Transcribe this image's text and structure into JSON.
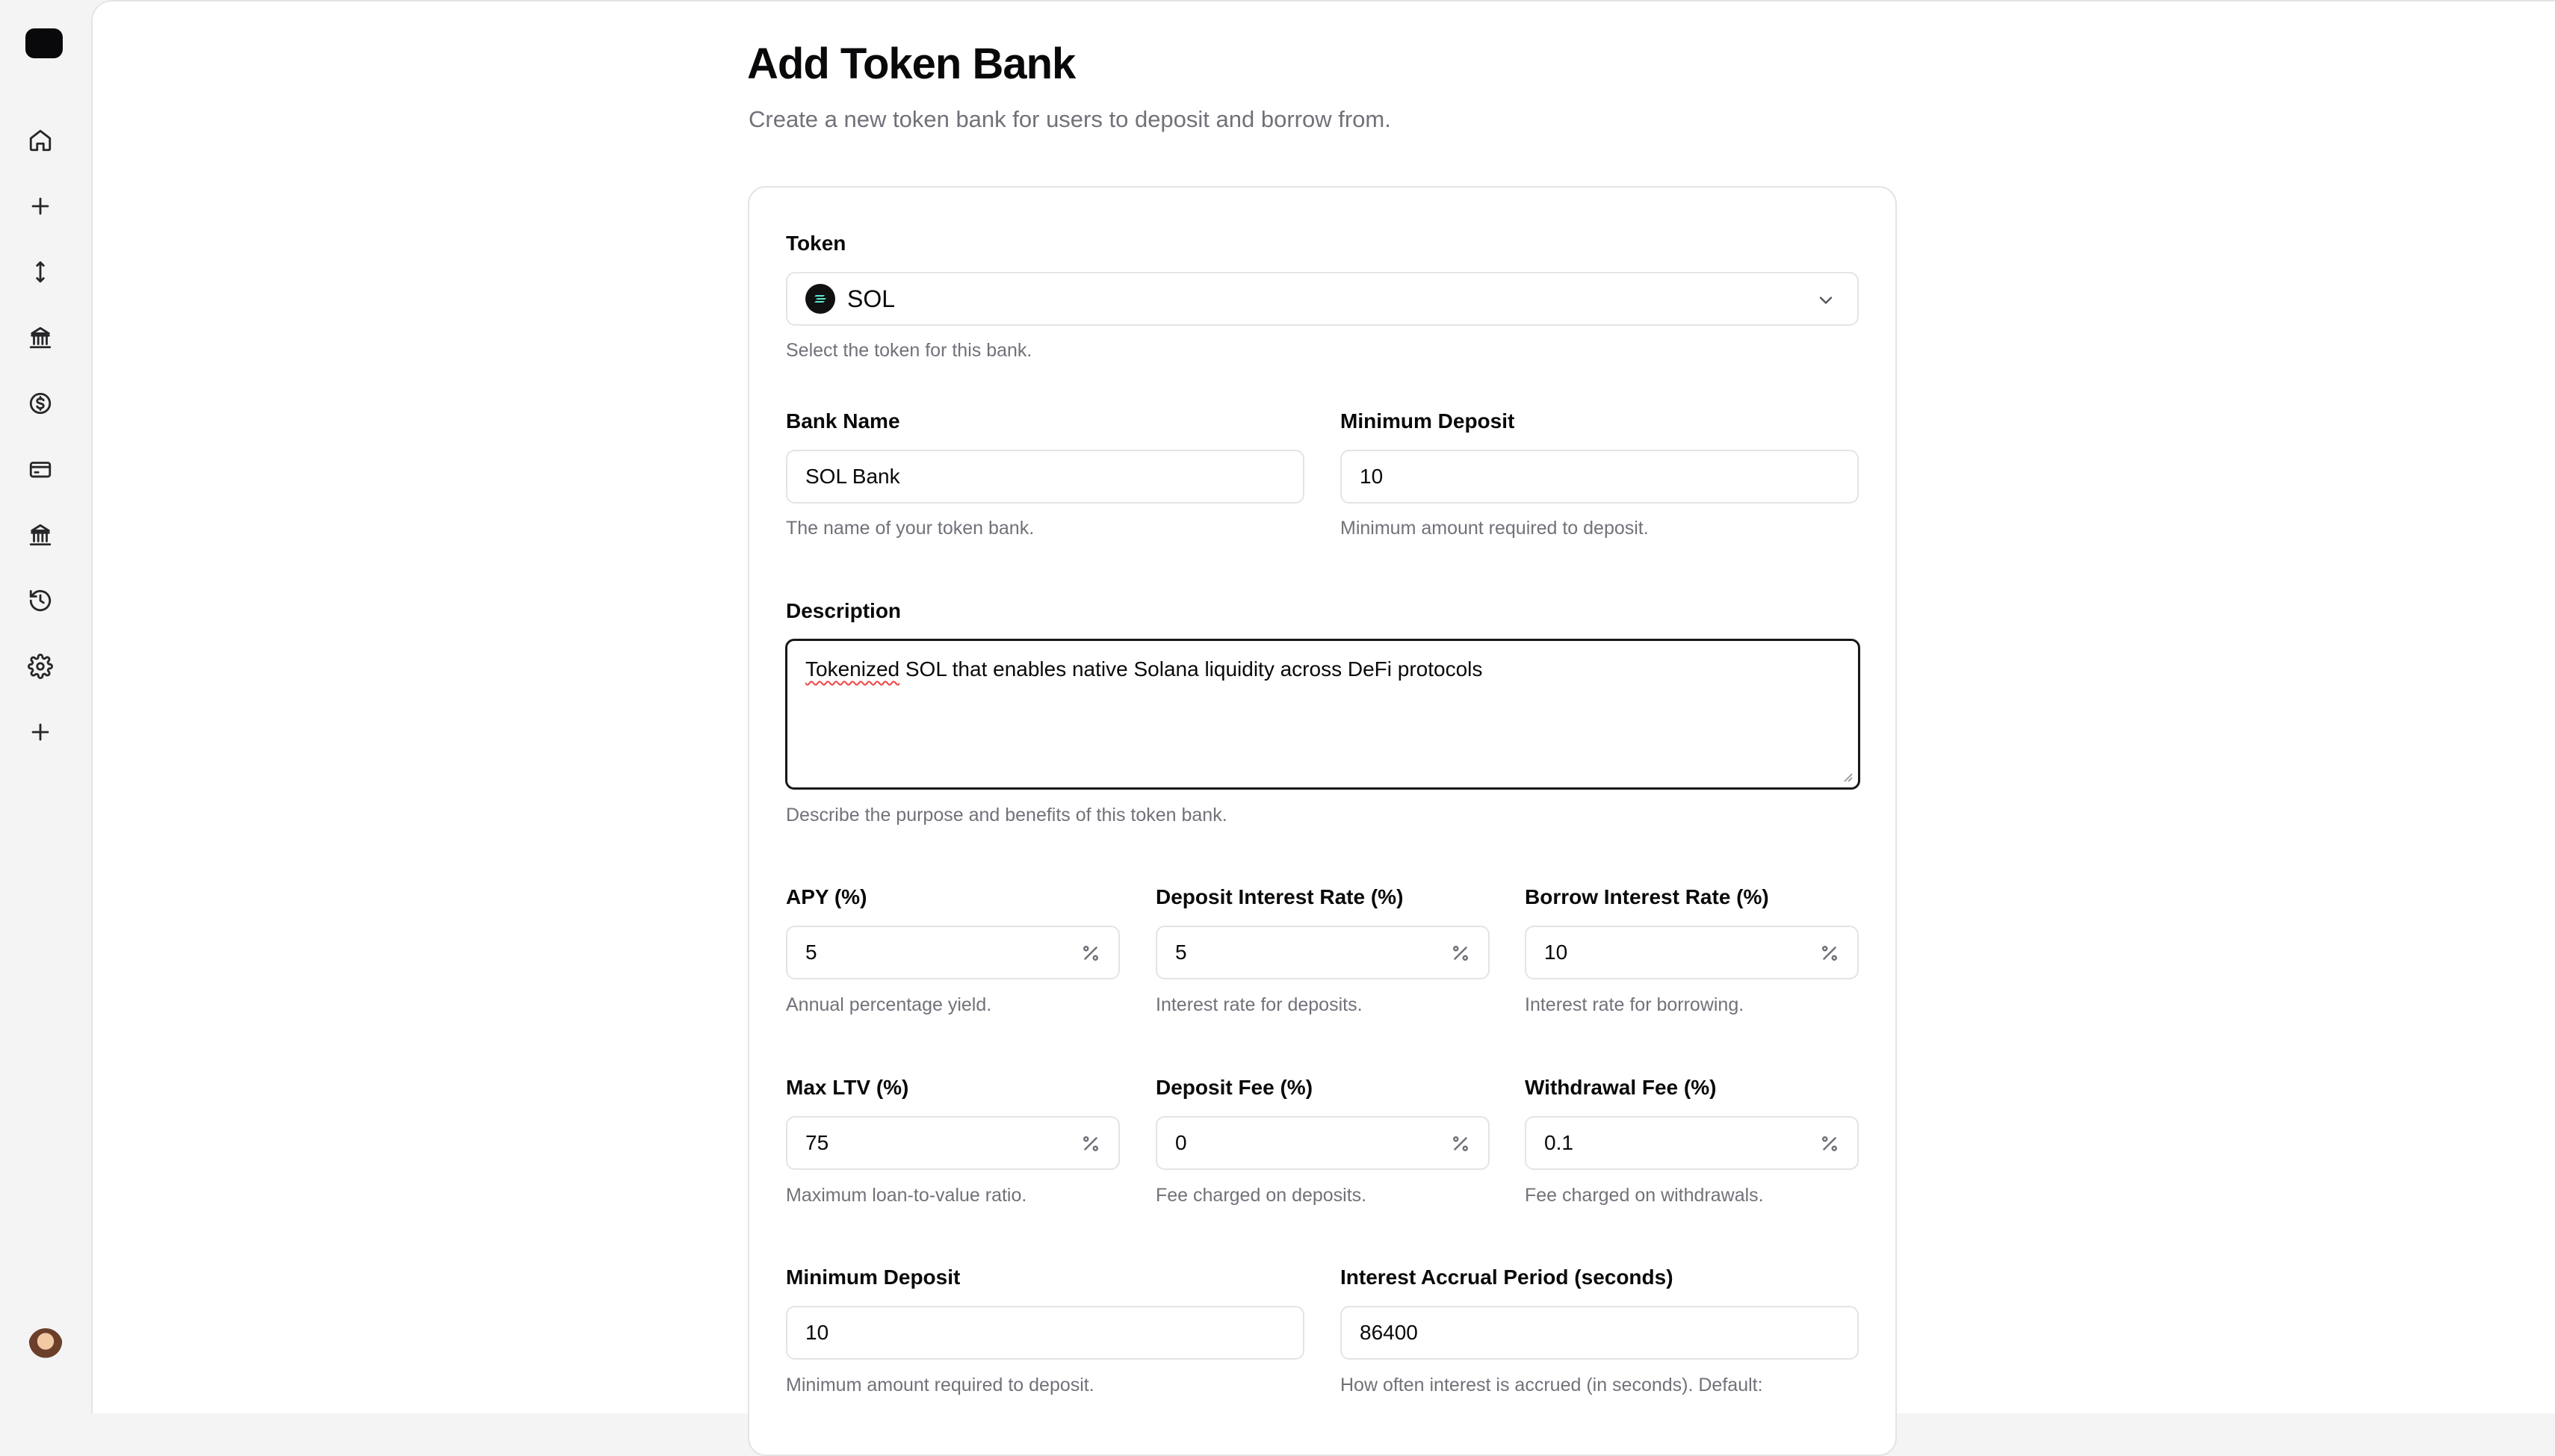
{
  "page": {
    "title": "Add Token Bank",
    "subtitle": "Create a new token bank for users to deposit and borrow from."
  },
  "sidebar": {
    "items": [
      {
        "icon": "home-icon"
      },
      {
        "icon": "plus-icon"
      },
      {
        "icon": "arrows-vertical-icon"
      },
      {
        "icon": "bank-icon"
      },
      {
        "icon": "dollar-icon"
      },
      {
        "icon": "credit-card-icon"
      },
      {
        "icon": "bank-icon"
      },
      {
        "icon": "history-icon"
      },
      {
        "icon": "gear-icon"
      },
      {
        "icon": "plus-icon"
      }
    ]
  },
  "form": {
    "token": {
      "label": "Token",
      "value": "SOL",
      "hint": "Select the token for this bank."
    },
    "bank_name": {
      "label": "Bank Name",
      "value": "SOL Bank",
      "hint": "The name of your token bank."
    },
    "min_deposit_top": {
      "label": "Minimum Deposit",
      "value": "10",
      "hint": "Minimum amount required to deposit."
    },
    "description": {
      "label": "Description",
      "value_misspelled": "Tokenized",
      "value_rest": " SOL that enables native Solana liquidity across DeFi protocols",
      "hint": "Describe the purpose and benefits of this token bank."
    },
    "apy": {
      "label": "APY (%)",
      "value": "5",
      "hint": "Annual percentage yield."
    },
    "deposit_rate": {
      "label": "Deposit Interest Rate (%)",
      "value": "5",
      "hint": "Interest rate for deposits."
    },
    "borrow_rate": {
      "label": "Borrow Interest Rate (%)",
      "value": "10",
      "hint": "Interest rate for borrowing."
    },
    "max_ltv": {
      "label": "Max LTV (%)",
      "value": "75",
      "hint": "Maximum loan-to-value ratio."
    },
    "deposit_fee": {
      "label": "Deposit Fee (%)",
      "value": "0",
      "hint": "Fee charged on deposits."
    },
    "withdrawal_fee": {
      "label": "Withdrawal Fee (%)",
      "value": "0.1",
      "hint": "Fee charged on withdrawals."
    },
    "min_deposit_bottom": {
      "label": "Minimum Deposit",
      "value": "10",
      "hint": "Minimum amount required to deposit."
    },
    "interest_period": {
      "label": "Interest Accrual Period (seconds)",
      "value": "86400",
      "hint": "How often interest is accrued (in seconds). Default:"
    }
  },
  "colors": {
    "accent": "#09090b",
    "muted_text": "#71717a",
    "border": "#e4e4e7"
  }
}
